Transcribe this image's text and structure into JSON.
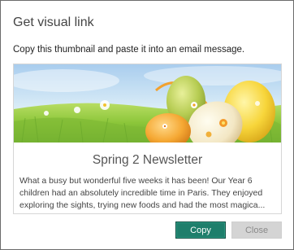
{
  "dialog": {
    "title": "Get visual link",
    "instruction": "Copy this thumbnail and paste it into an email message."
  },
  "card": {
    "image": "easter-eggs-in-grass-thumbnail",
    "title": "Spring 2 Newsletter",
    "description": "What a busy but wonderful five weeks it has been! Our Year 6 children had an absolutely incredible time in Paris. They enjoyed exploring the sights, trying new foods and had the most magica..."
  },
  "buttons": {
    "copy_label": "Copy",
    "close_label": "Close"
  },
  "colors": {
    "primary_button": "#1e7e6b",
    "disabled_button": "#d4d4d4"
  }
}
